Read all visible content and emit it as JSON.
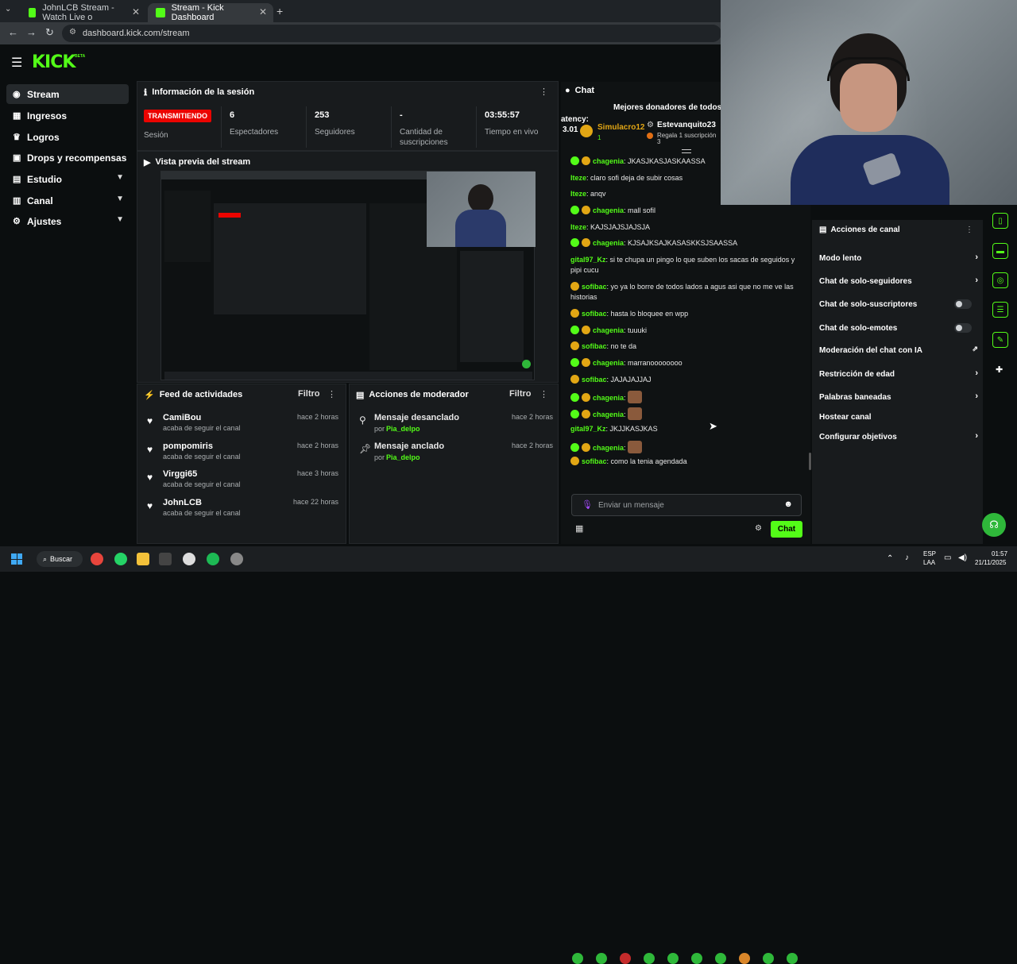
{
  "browser": {
    "tabs": [
      {
        "title": "JohnLCB Stream - Watch Live o",
        "active": false
      },
      {
        "title": "Stream - Kick Dashboard",
        "active": true
      }
    ],
    "url": "dashboard.kick.com/stream"
  },
  "header": {
    "logo": "KICK",
    "logo_badge": "BETA"
  },
  "sidebar": {
    "items": [
      {
        "label": "Stream",
        "icon": "broadcast-icon"
      },
      {
        "label": "Ingresos",
        "icon": "revenue-icon"
      },
      {
        "label": "Logros",
        "icon": "trophy-icon"
      },
      {
        "label": "Drops y recompensas",
        "icon": "gift-icon"
      },
      {
        "label": "Estudio",
        "icon": "studio-icon"
      },
      {
        "label": "Canal",
        "icon": "channel-icon"
      },
      {
        "label": "Ajustes",
        "icon": "gear-icon"
      }
    ]
  },
  "session": {
    "title": "Información de la sesión",
    "status": "TRANSMITIENDO",
    "status_label": "Sesión",
    "viewers": "6",
    "viewers_label": "Espectadores",
    "followers": "253",
    "followers_label": "Seguidores",
    "subs": "-",
    "subs_label": "Cantidad de suscripciones",
    "uptime": "03:55:57",
    "uptime_label": "Tiempo en vivo"
  },
  "preview": {
    "title": "Vista previa del stream"
  },
  "feed": {
    "title": "Feed de actividades",
    "filter": "Filtro",
    "items": [
      {
        "name": "CamiBou",
        "sub": "acaba de seguir el canal",
        "time": "hace 2 horas"
      },
      {
        "name": "pompomiris",
        "sub": "acaba de seguir el canal",
        "time": "hace 2 horas"
      },
      {
        "name": "Virggi65",
        "sub": "acaba de seguir el canal",
        "time": "hace 3 horas"
      },
      {
        "name": "JohnLCB",
        "sub": "acaba de seguir el canal",
        "time": "hace 22 horas"
      }
    ]
  },
  "modactions": {
    "title": "Acciones de moderador",
    "filter": "Filtro",
    "items": [
      {
        "label": "Mensaje desanclado",
        "by": "por",
        "user": "Pia_delpo",
        "time": "hace 2 horas"
      },
      {
        "label": "Mensaje anclado",
        "by": "por",
        "user": "Pia_delpo",
        "time": "hace 2 horas"
      }
    ]
  },
  "chat": {
    "title": "Chat",
    "top_donors": "Mejores donadores de todos l",
    "latency": "atency:",
    "latency_val": "3.01",
    "donor1": "Simulacro12",
    "donor1_count": "1",
    "donor2": "Estevanquito23",
    "donor2_sub": "Regala 1 suscripción",
    "donor2_count": "3",
    "messages": [
      {
        "user": "chagenia",
        "color": "#53fc18",
        "text": "JKASJKASJASKAASSA",
        "badges": 2
      },
      {
        "user": "Iteze",
        "color": "#53fc18",
        "text": "claro sofi deja de subir cosas",
        "badges": 0
      },
      {
        "user": "Iteze",
        "color": "#53fc18",
        "text": "anqv",
        "badges": 0
      },
      {
        "user": "chagenia",
        "color": "#53fc18",
        "text": "mall sofil",
        "badges": 2
      },
      {
        "user": "Iteze",
        "color": "#53fc18",
        "text": "KAJSJAJSJAJSJA",
        "badges": 0
      },
      {
        "user": "chagenia",
        "color": "#53fc18",
        "text": "KJSAJKSAJKASASKKSJSAASSA",
        "badges": 2
      },
      {
        "user": "gital97_Kz",
        "color": "#53fc18",
        "text": "si te chupa un pingo lo que suben los sacas de seguidos y pipi cucu",
        "badges": 0
      },
      {
        "user": "sofibac",
        "color": "#53fc18",
        "text": "yo ya lo borre de todos lados a agus asi que no me ve las historias",
        "badges": 1
      },
      {
        "user": "sofibac",
        "color": "#53fc18",
        "text": "hasta lo bloquee en wpp",
        "badges": 1
      },
      {
        "user": "chagenia",
        "color": "#53fc18",
        "text": "tuuuki",
        "badges": 2
      },
      {
        "user": "sofibac",
        "color": "#53fc18",
        "text": "no te da",
        "badges": 1
      },
      {
        "user": "chagenia",
        "color": "#53fc18",
        "text": "marranoooooooo",
        "badges": 2
      },
      {
        "user": "sofibac",
        "color": "#53fc18",
        "text": "JAJAJAJJAJ",
        "badges": 1
      },
      {
        "user": "chagenia",
        "color": "#53fc18",
        "text": "",
        "badges": 2,
        "emoji": true
      },
      {
        "user": "chagenia",
        "color": "#53fc18",
        "text": "",
        "badges": 2,
        "emoji": true
      },
      {
        "user": "gital97_Kz",
        "color": "#53fc18",
        "text": "JKJJKASJKAS",
        "badges": 0
      },
      {
        "user": "chagenia",
        "color": "#53fc18",
        "text": "",
        "badges": 2,
        "emoji": true
      },
      {
        "user": "sofibac",
        "color": "#53fc18",
        "text": "como la tenia agendada",
        "badges": 1
      }
    ],
    "input_placeholder": "Enviar un mensaje",
    "send_label": "Chat"
  },
  "channel_actions": {
    "title": "Acciones de canal",
    "items": [
      {
        "label": "Modo lento",
        "control": "chevron"
      },
      {
        "label": "Chat de solo-seguidores",
        "control": "chevron"
      },
      {
        "label": "Chat de solo-suscriptores",
        "control": "toggle"
      },
      {
        "label": "Chat de solo-emotes",
        "control": "toggle"
      },
      {
        "label": "Moderación del chat con IA",
        "control": "external"
      },
      {
        "label": "Restricción de edad",
        "control": "chevron"
      },
      {
        "label": "Palabras baneadas",
        "control": "chevron"
      },
      {
        "label": "Hostear canal",
        "control": "none"
      },
      {
        "label": "Configurar objetivos",
        "control": "chevron"
      }
    ]
  },
  "taskbar": {
    "search": "Buscar",
    "lang": "ESP",
    "lang2": "LAA",
    "time": "01:57",
    "date": "21/11/2025"
  },
  "colors": {
    "accent": "#53fc18",
    "live": "#eb0400",
    "bg": "#0b0e0f",
    "panel": "#181b1d"
  }
}
